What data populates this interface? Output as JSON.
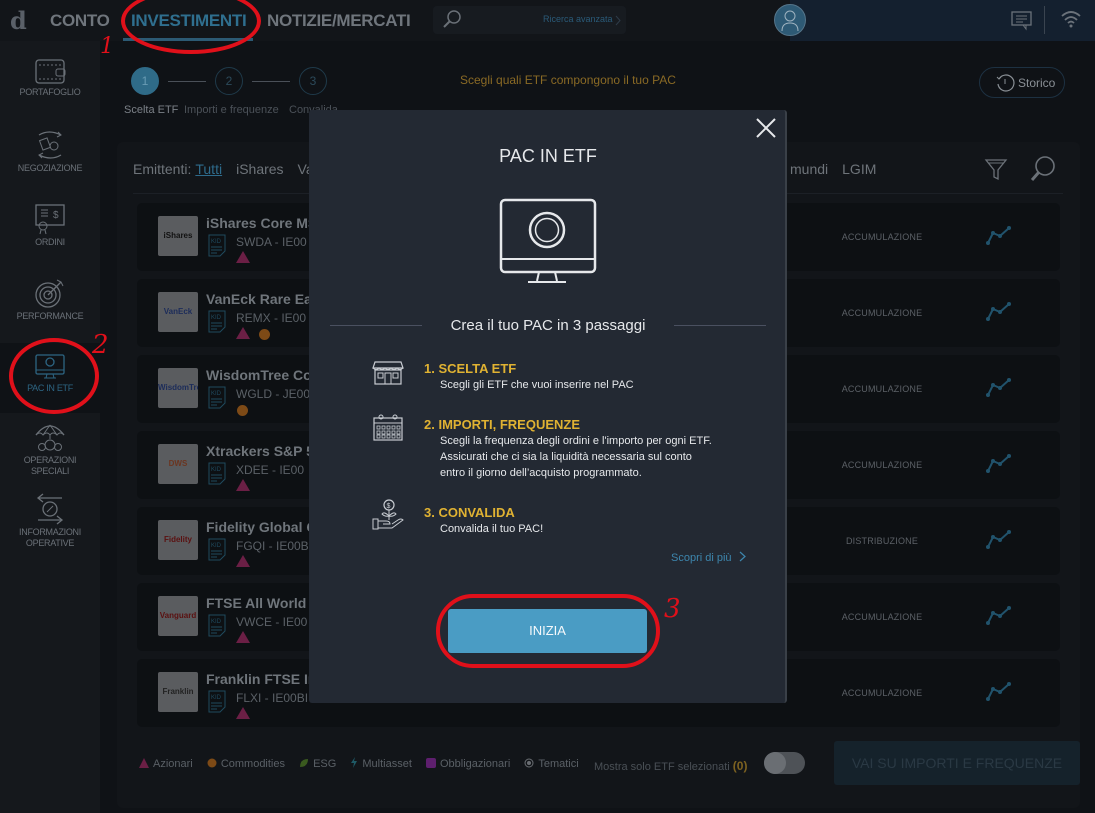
{
  "topbar": {
    "logo": "d",
    "nav": [
      {
        "label": "CONTO",
        "active": false
      },
      {
        "label": "INVESTIMENTI",
        "active": true
      },
      {
        "label": "NOTIZIE/MERCATI",
        "active": false
      }
    ],
    "search": {
      "placeholder": "",
      "advanced_label": "Ricerca avanzata"
    },
    "icons": [
      "avatar-icon",
      "chat-icon",
      "wifi-icon"
    ]
  },
  "sidebar": {
    "items": [
      {
        "label": "PORTAFOGLIO",
        "icon": "wallet-icon",
        "active": false
      },
      {
        "label": "NEGOZIAZIONE",
        "icon": "exchange-icon",
        "active": false
      },
      {
        "label": "ORDINI",
        "icon": "certificate-icon",
        "active": false
      },
      {
        "label": "PERFORMANCE",
        "icon": "target-icon",
        "active": false
      },
      {
        "label": "PAC IN ETF",
        "icon": "monitor-icon",
        "active": true
      },
      {
        "label": "OPERAZIONI\nSPECIALI",
        "label_lines": [
          "OPERAZIONI",
          "SPECIALI"
        ],
        "icon": "umbrella-coins-icon",
        "active": false
      },
      {
        "label": "INFORMAZIONI\nOPERATIVE",
        "label_lines": [
          "INFORMAZIONI",
          "OPERATIVE"
        ],
        "icon": "transfer-icon",
        "active": false
      }
    ]
  },
  "stepper": {
    "steps": [
      {
        "number": "1",
        "label": "Scelta ETF",
        "active": true
      },
      {
        "number": "2",
        "label": "Importi e frequenze",
        "active": false
      },
      {
        "number": "3",
        "label": "Convalida",
        "active": false
      }
    ],
    "instruction": "Scegli quali ETF compongono il tuo PAC",
    "history_button": "Storico"
  },
  "filters": {
    "label": "Emittenti:",
    "issuers_left": [
      "Tutti",
      "iShares",
      "Va"
    ],
    "issuers_right": [
      "mundi",
      "LGIM"
    ],
    "selected": "Tutti"
  },
  "etfs": [
    {
      "logo": "iShares",
      "name": "iShares Core MS",
      "code": "SWDA - IE00",
      "markers": [
        "azionari"
      ],
      "type": "ACCUMULAZIONE"
    },
    {
      "logo": "VanEck",
      "name": "VanEck Rare Ear",
      "code": "REMX - IE00",
      "markers": [
        "azionari",
        "commodities"
      ],
      "type": "ACCUMULAZIONE"
    },
    {
      "logo": "WisdomTree",
      "name": "WisdomTree Co",
      "code": "WGLD - JE00",
      "markers": [
        "commodities"
      ],
      "type": "ACCUMULAZIONE"
    },
    {
      "logo": "DWS Xtrackers",
      "name": "Xtrackers S&P 5",
      "code": "XDEE - IE00",
      "markers": [
        "azionari"
      ],
      "type": "ACCUMULAZIONE"
    },
    {
      "logo": "Fidelity",
      "name": "Fidelity Global C",
      "code": "FGQI - IE00B",
      "markers": [
        "azionari"
      ],
      "type": "DISTRIBUZIONE"
    },
    {
      "logo": "Vanguard",
      "name": "FTSE All World U",
      "code": "VWCE - IE00",
      "markers": [
        "azionari"
      ],
      "type": "ACCUMULAZIONE"
    },
    {
      "logo": "Franklin",
      "name": "Franklin FTSE In",
      "code": "FLXI - IE00BI",
      "markers": [
        "azionari"
      ],
      "type": "ACCUMULAZIONE"
    }
  ],
  "legend": [
    {
      "label": "Azionari",
      "marker": "triangle",
      "color": "#6b1f45"
    },
    {
      "label": "Commodities",
      "marker": "circle",
      "color": "#7d4a16"
    },
    {
      "label": "ESG",
      "marker": "leaf",
      "color": "#3a5a1f"
    },
    {
      "label": "Multiasset",
      "marker": "bolt",
      "color": "#1f5a66"
    },
    {
      "label": "Obbligazionari",
      "marker": "square",
      "color": "#5e1f6e"
    },
    {
      "label": "Tematici",
      "marker": "target",
      "color": "#6a6e73"
    }
  ],
  "footer": {
    "only_selected_label": "Mostra solo ETF selezionati",
    "selected_count": "(0)",
    "toggle_on": false,
    "next_button": "VAI SU IMPORTI E FREQUENZE"
  },
  "modal": {
    "title": "PAC IN ETF",
    "subtitle": "Crea il tuo PAC in 3 passaggi",
    "steps": [
      {
        "title": "1. SCELTA ETF",
        "text_lines": [
          "Scegli gli ETF che vuoi inserire nel PAC"
        ],
        "icon": "shop-icon"
      },
      {
        "title": "2. IMPORTI, FREQUENZE",
        "text_lines": [
          "Scegli la frequenza degli ordini e l'importo per ogni ETF.",
          "Assicurati che ci sia la liquidità necessaria sul conto",
          "entro il giorno dell’acquisto programmato."
        ],
        "icon": "calendar-icon"
      },
      {
        "title": "3. CONVALIDA",
        "text_lines": [
          "Convalida il tuo PAC!"
        ],
        "icon": "money-plant-hand-icon"
      }
    ],
    "learn_more": "Scopri di più",
    "start_button": "INIZIA"
  },
  "annotations": [
    "1",
    "2",
    "3"
  ],
  "colors": {
    "accent": "#4a9cc4",
    "step_title": "#e0b232",
    "annotation": "#e0101a",
    "modal_bg": "#232933"
  }
}
